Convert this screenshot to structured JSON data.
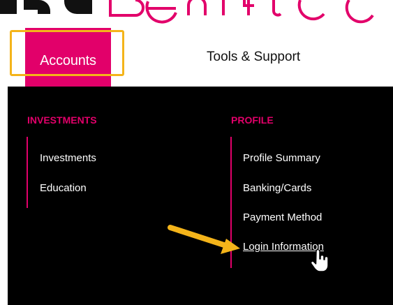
{
  "brand": {
    "logo_text_fragment": "Benefit C"
  },
  "nav": {
    "tabs": [
      {
        "label": "Accounts",
        "active": true
      },
      {
        "label": "Tools & Support",
        "active": false
      }
    ]
  },
  "menu": {
    "columns": [
      {
        "title": "INVESTMENTS",
        "items": [
          "Investments",
          "Education"
        ]
      },
      {
        "title": "PROFILE",
        "items": [
          "Profile Summary",
          "Banking/Cards",
          "Payment Method",
          "Login Information"
        ]
      }
    ]
  },
  "colors": {
    "accent": "#e2006a",
    "highlight": "#f4b41a",
    "menu_background": "#000000"
  }
}
